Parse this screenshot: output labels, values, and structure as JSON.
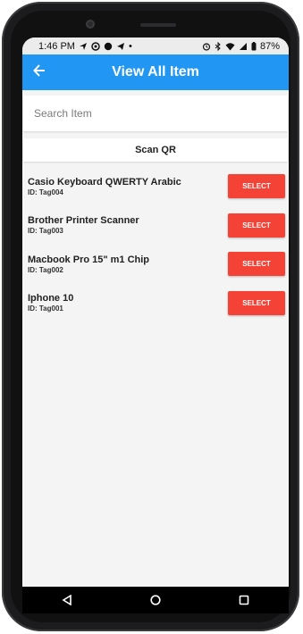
{
  "status": {
    "time": "1:46 PM",
    "battery": "87%"
  },
  "appbar": {
    "title": "View All Item",
    "back_icon": "arrow-left-icon"
  },
  "search": {
    "placeholder": "Search Item",
    "value": ""
  },
  "scan": {
    "label": "Scan QR"
  },
  "items": [
    {
      "name": "Casio Keyboard QWERTY Arabic",
      "id": "ID: Tag004",
      "button": "SELECT"
    },
    {
      "name": "Brother Printer Scanner",
      "id": "ID: Tag003",
      "button": "SELECT"
    },
    {
      "name": "Macbook Pro 15\" m1 Chip",
      "id": "ID: Tag002",
      "button": "SELECT"
    },
    {
      "name": "Iphone 10",
      "id": "ID: Tag001",
      "button": "SELECT"
    }
  ],
  "colors": {
    "appbar": "#2196f3",
    "select_button": "#f44336"
  },
  "navbar": {
    "icons": [
      "back-triangle-icon",
      "home-circle-icon",
      "recents-square-icon"
    ]
  }
}
